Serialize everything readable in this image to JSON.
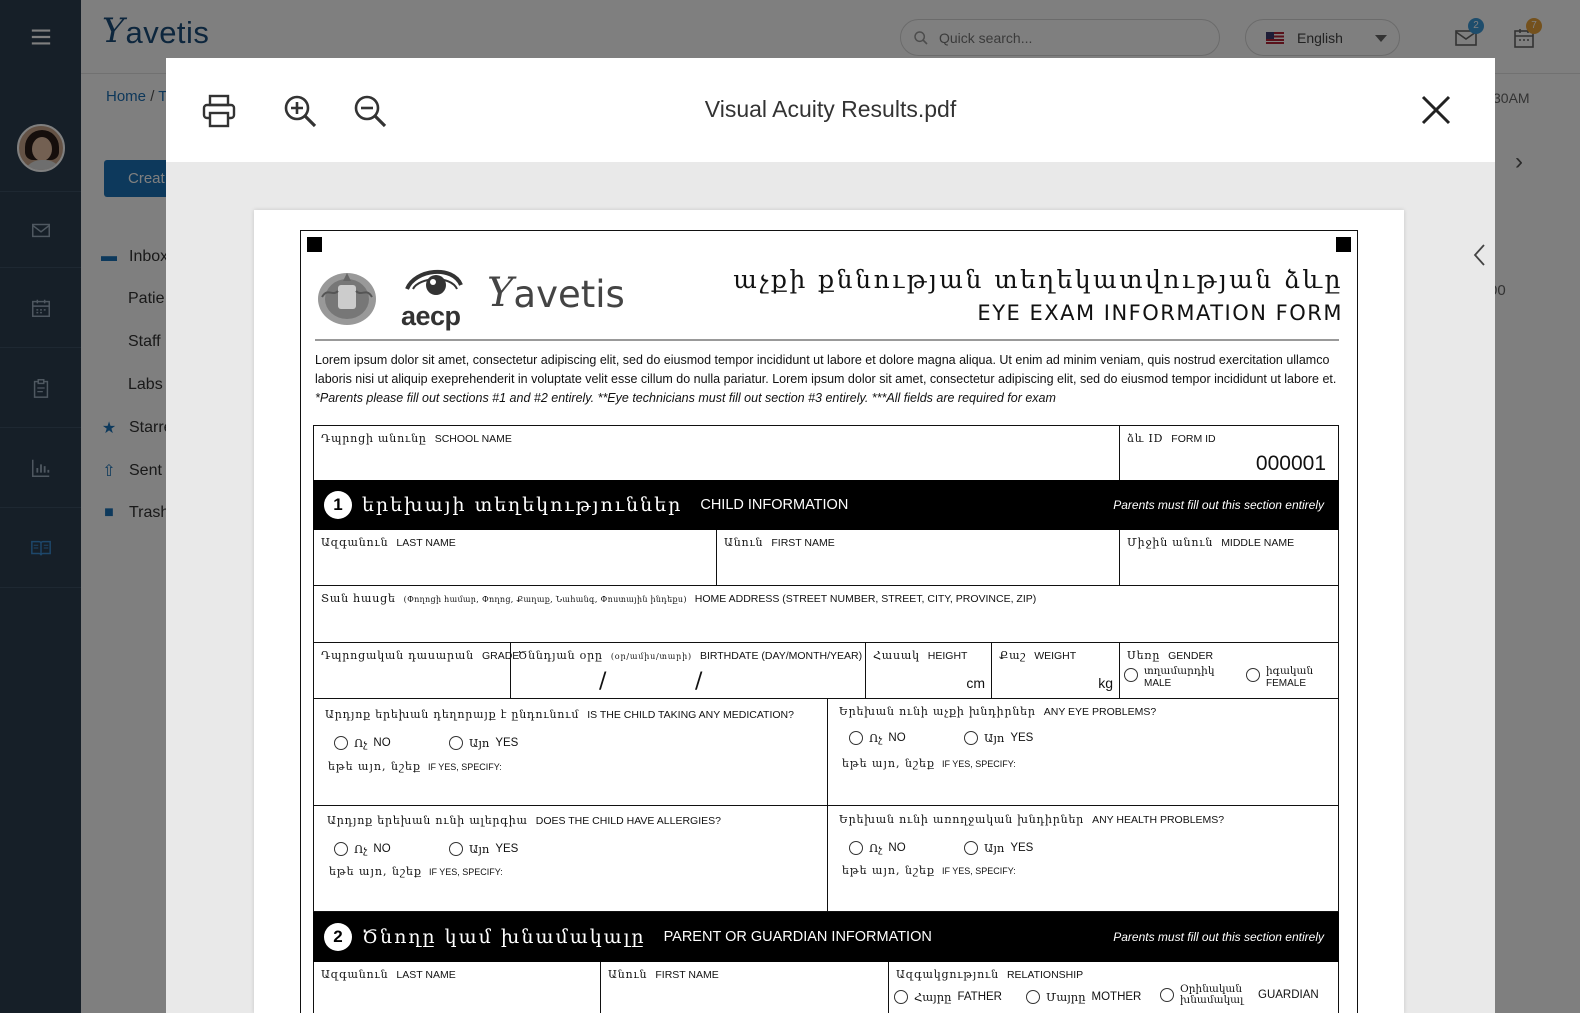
{
  "app": {
    "brand": "avetis",
    "search_placeholder": "Quick search...",
    "language": "English",
    "mail_badge": "2",
    "calendar_badge": "7",
    "breadcrumb_home": "Home",
    "breadcrumb_sep": "/",
    "breadcrumb_next": "T",
    "time_fragment": "30AM",
    "side_value_fragment": "00",
    "create_label": "Creat",
    "nav": [
      {
        "label": "Inbox"
      },
      {
        "label": "Patie"
      },
      {
        "label": "Staff"
      },
      {
        "label": "Labs"
      },
      {
        "label": "Starre"
      },
      {
        "label": "Sent"
      },
      {
        "label": "Trash"
      }
    ]
  },
  "modal": {
    "title": "Visual Acuity Results.pdf"
  },
  "pdf": {
    "aecp": "aecp",
    "brand": "avetis",
    "title_arm": "աչքի քննության տեղեկատվության ձևը",
    "title_en": "EYE EXAM INFORMATION FORM",
    "lorem1": "Lorem ipsum dolor sit amet, consectetur adipiscing elit, sed do eiusmod tempor incididunt ut labore et dolore magna aliqua. Ut enim ad minim veniam, quis nostrud exercitation ullamco laboris nisi ut aliquip exeprehenderit in voluptate velit esse cillum do nulla pariatur. Lorem ipsum dolor sit amet, consectetur adipiscing elit, sed do eiusmod tempor incididunt ut labore et.",
    "lorem_note": "*Parents please fill out sections #1 and #2 entirely. **Eye technicians must fill out section #3 entirely. ***All fields are required for exam",
    "school_arm": "Դպրոցի անունը",
    "school_en": "SCHOOL NAME",
    "formid_arm": "ձև ID",
    "formid_en": "FORM ID",
    "form_id": "000001",
    "sec1_num": "1",
    "sec1_arm": "երեխայի տեղեկություններ",
    "sec1_en": "CHILD INFORMATION",
    "sec_note": "Parents must fill out this section entirely",
    "last_arm": "Ազգանուն",
    "last_en": "LAST NAME",
    "first_arm": "Անուն",
    "first_en": "FIRST NAME",
    "middle_arm": "Միջին անուն",
    "middle_en": "MIDDLE NAME",
    "address_arm": "Տան հասցե",
    "address_arm_sub": "(Փողոցի համար, Փողոց, Քաղաք, Նահանգ, Փոստային ինդեքս)",
    "address_en": "HOME ADDRESS (STREET NUMBER, STREET, CITY, PROVINCE, ZIP)",
    "grade_arm": "Դպրոցական դասարան",
    "grade_en": "GRADE",
    "birth_arm": "Ծննդյան օրը",
    "birth_arm_sub": "(օր/ամիս/տարի)",
    "birth_en": "BIRTHDATE (DAY/MONTH/YEAR)",
    "slash": "/",
    "height_arm": "Հասակ",
    "height_en": "HEIGHT",
    "height_unit": "cm",
    "weight_arm": "Քաշ",
    "weight_en": "WEIGHT",
    "weight_unit": "kg",
    "gender_arm": "Սեռը",
    "gender_en": "GENDER",
    "male_arm": "տղամարդիկ",
    "male_en": "MALE",
    "female_arm": "իգական",
    "female_en": "FEMALE",
    "med_arm": "Արդյոք երեխան դեղորայք է ընդունում",
    "med_en": "IS THE CHILD TAKING ANY MEDICATION?",
    "eye_arm": "Երեխան ունի աչքի խնդիրներ",
    "eye_en": "ANY EYE PROBLEMS?",
    "allergy_arm": "Արդյոք երեխան ունի ալերգիա",
    "allergy_en": "DOES THE CHILD HAVE ALLERGIES?",
    "health_arm": "Երեխան ունի առողջական խնդիրներ",
    "health_en": "ANY HEALTH PROBLEMS?",
    "no_arm": "Ոչ",
    "no_en": "NO",
    "yes_arm": "Այո",
    "yes_en": "YES",
    "specify_arm": "եթե այո, նշեք",
    "specify_en": "IF YES, SPECIFY:",
    "sec2_num": "2",
    "sec2_arm": "Ծնողը կամ խնամակալը",
    "sec2_en": "PARENT OR GUARDIAN INFORMATION",
    "rel_arm": "Ազգակցություն",
    "rel_en": "RELATIONSHIP",
    "father_arm": "Հայրը",
    "father_en": "FATHER",
    "mother_arm": "Մայրը",
    "mother_en": "MOTHER",
    "guardian_arm": "Օրինական խնամակալ",
    "guardian_en": "GUARDIAN"
  }
}
